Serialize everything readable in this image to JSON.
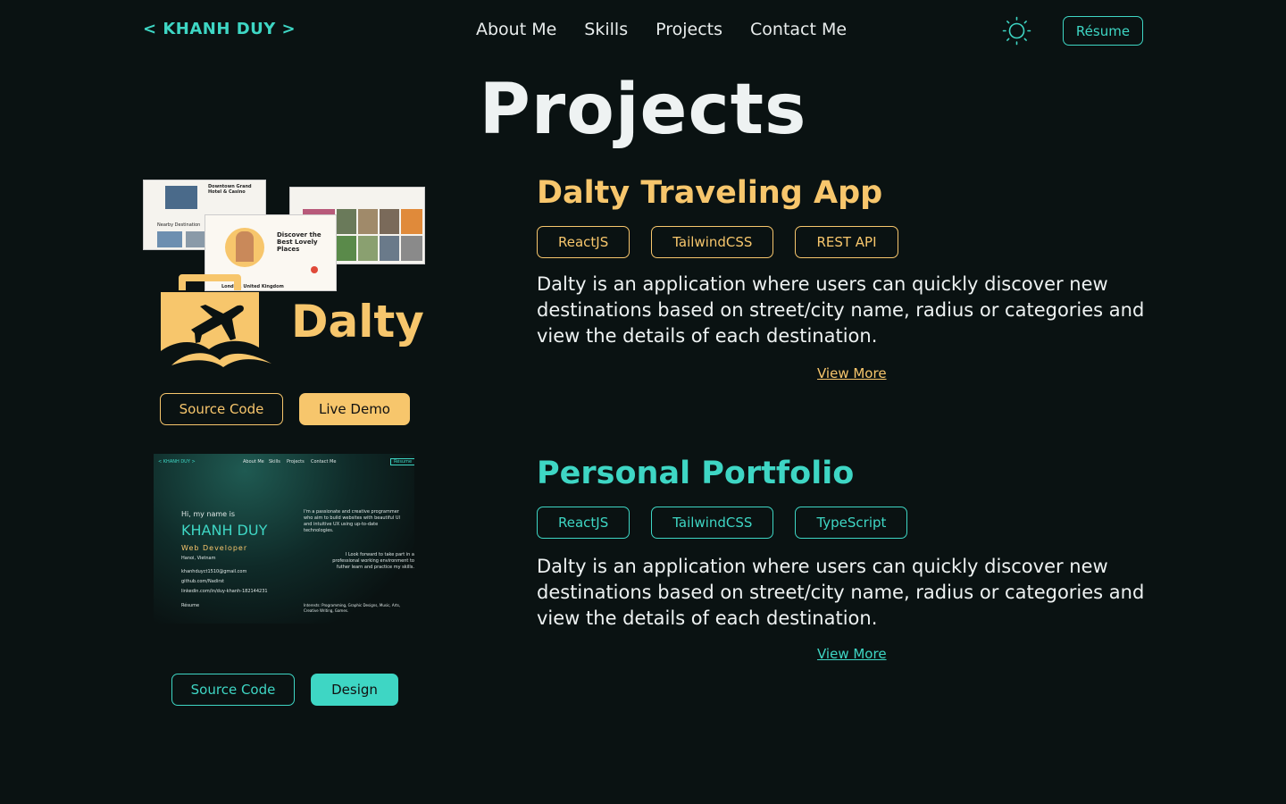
{
  "nav": {
    "logo": "< KHANH DUY >",
    "links": [
      "About Me",
      "Skills",
      "Projects",
      "Contact Me"
    ],
    "resume": "Résume"
  },
  "page_title": "Projects",
  "projects": [
    {
      "title": "Dalty Traveling App",
      "tags": [
        "ReactJS",
        "TailwindCSS",
        "REST API"
      ],
      "description": "Dalty is an application where users can quickly discover new destinations based on street/city name, radius or categories and view the details of each destination.",
      "view_more": "View More",
      "buttons": [
        "Source Code",
        "Live Demo"
      ],
      "logo_text": "Dalty",
      "thumb_texts": {
        "hotel": "Downtown Grand Hotel & Casino",
        "discover": "Discover the Best Lovely Places",
        "location": "London, United Kingdom",
        "nearby": "Nearby Destination"
      },
      "accent": "#f7c66c"
    },
    {
      "title": "Personal Portfolio",
      "tags": [
        "ReactJS",
        "TailwindCSS",
        "TypeScript"
      ],
      "description": "Dalty is an application where users can quickly discover new destinations based on street/city name, radius or categories and view the details of each destination.",
      "view_more": "View More",
      "buttons": [
        "Source Code",
        "Design"
      ],
      "thumb_texts": {
        "logo": "< KHANH DUY >",
        "nav": [
          "About Me",
          "Skills",
          "Projects",
          "Contact Me"
        ],
        "resume": "Résume",
        "hi": "Hi, my name is",
        "name": "KHANH DUY",
        "role": "Web Developer",
        "location": "Hanoi, Vietnam",
        "email": "khanhduyct1510@gmail.com",
        "github": "github.com/Nadirst",
        "linkedin": "linkedin.com/in/duy-khanh-182144231",
        "resume2": "Résume",
        "intro1": "I'm a passionate and creative programmer who aim to build websites with beautiful UI and intuitive UX using up-to-date technologies.",
        "intro2": "I Look forward to take part in a professional working environment to futher learn and practice my skills.",
        "interests": "Interests: Programming, Graphic Designs, Music, Arts, Creative Writing, Games."
      },
      "accent": "#3ed6c4"
    }
  ],
  "colors": {
    "background": "#0a1212",
    "teal": "#3ed6c4",
    "amber": "#f7c66c"
  },
  "icons": {
    "theme_toggle": "sun-icon"
  }
}
